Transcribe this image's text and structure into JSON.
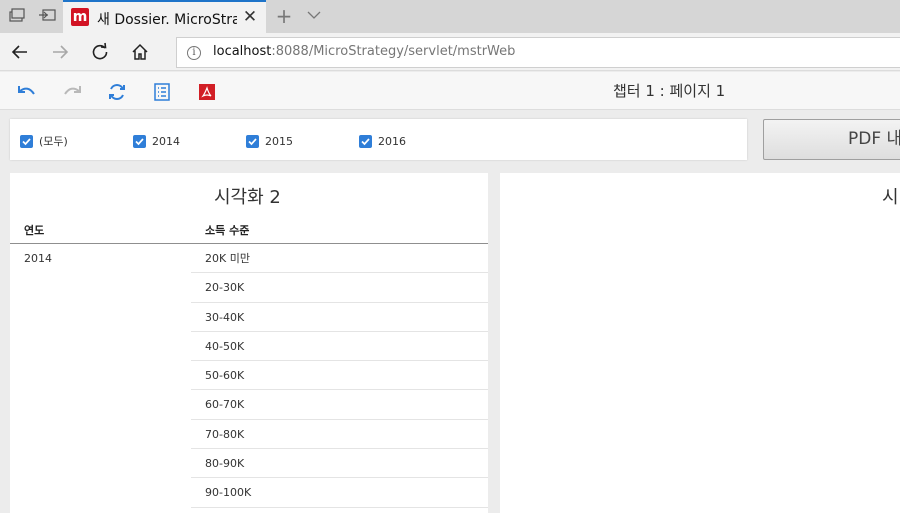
{
  "browser": {
    "tab": {
      "title": "새 Dossier. MicroStrategy",
      "logo_letter": "m"
    },
    "address": {
      "host": "localhost",
      "rest": ":8088/MicroStrategy/servlet/mstrWeb"
    },
    "icons": {
      "tab_actions": "tabs-aside-icon",
      "set_aside": "set-aside-icon",
      "close": "close-icon",
      "new_tab": "plus-icon",
      "tab_list": "chevron-down-icon",
      "back": "back-arrow-icon",
      "forward": "forward-arrow-icon",
      "refresh": "refresh-icon",
      "home": "home-icon",
      "info": "info-icon"
    }
  },
  "toolbar": {
    "page_title": "챕터 1 : 페이지 1",
    "icons": [
      "undo-icon",
      "redo-icon",
      "refresh-icon",
      "table-of-contents-icon",
      "pdf-icon"
    ],
    "accent_color": "#2f7ed8",
    "pdf_color": "#d21f26"
  },
  "filter": {
    "items": [
      {
        "label": "(모두)",
        "checked": true
      },
      {
        "label": "2014",
        "checked": true
      },
      {
        "label": "2015",
        "checked": true
      },
      {
        "label": "2016",
        "checked": true
      }
    ]
  },
  "pdf_button": {
    "label": "PDF 내"
  },
  "visualizations": {
    "left": {
      "title": "시각화 2",
      "columns": [
        "연도",
        "소득 수준"
      ],
      "year": "2014",
      "income_levels": [
        "20K 미만",
        "20-30K",
        "30-40K",
        "40-50K",
        "50-60K",
        "60-70K",
        "70-80K",
        "80-90K",
        "90-100K"
      ]
    },
    "right": {
      "title": "시"
    }
  }
}
